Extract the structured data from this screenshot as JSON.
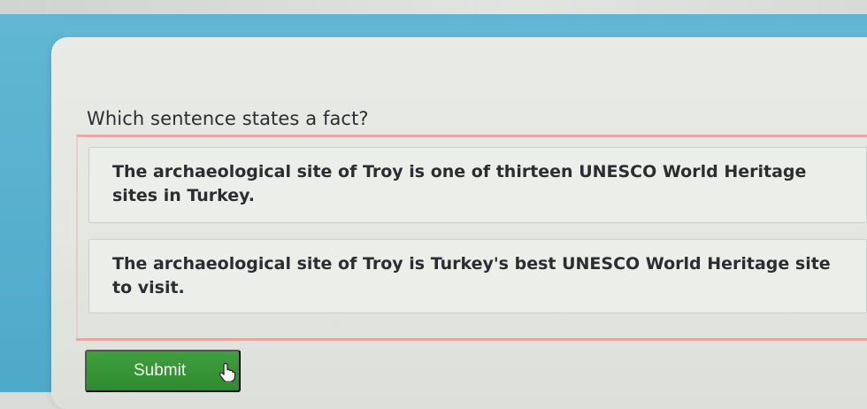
{
  "question": {
    "text": "Which sentence states a fact?"
  },
  "options": [
    {
      "text": "The archaeological site of Troy is one of thirteen UNESCO World Heritage sites in Turkey."
    },
    {
      "text": "The archaeological site of Troy is Turkey's best UNESCO World Heritage site to visit."
    }
  ],
  "submit": {
    "label": "Submit"
  },
  "colors": {
    "accent_blue": "#63b9d5",
    "submit_green": "#379535",
    "frame_red": "#e8a7a2"
  },
  "icons": {
    "cursor": "hand-pointer-icon"
  }
}
